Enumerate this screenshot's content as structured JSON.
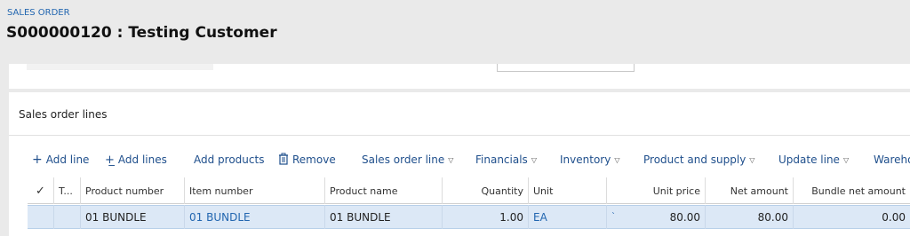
{
  "header": {
    "breadcrumb": "SALES ORDER",
    "title": "S000000120 : Testing Customer"
  },
  "section": {
    "title": "Sales order lines"
  },
  "toolbar": {
    "add_line": "Add line",
    "add_lines": "Add lines",
    "add_products": "Add products",
    "remove": "Remove",
    "sales_order_line": "Sales order line",
    "financials": "Financials",
    "inventory": "Inventory",
    "product_and_supply": "Product and supply",
    "update_line": "Update line",
    "warehouse": "Wareho"
  },
  "grid": {
    "columns": {
      "select": "✓",
      "type": "T...",
      "product_number": "Product number",
      "item_number": "Item number",
      "product_name": "Product name",
      "quantity": "Quantity",
      "unit": "Unit",
      "unit_price": "Unit price",
      "net_amount": "Net amount",
      "bundle_net_amount": "Bundle net amount"
    },
    "rows": [
      {
        "product_number": "01 BUNDLE",
        "item_number": "01 BUNDLE",
        "product_name": "01 BUNDLE",
        "quantity": "1.00",
        "unit": "EA",
        "marker": "ˋ",
        "unit_price": "80.00",
        "net_amount": "80.00",
        "bundle_net_amount": "0.00"
      }
    ]
  },
  "colors": {
    "link": "#2266b0",
    "selected_row": "#dce8f6",
    "background": "#eaeaea"
  }
}
